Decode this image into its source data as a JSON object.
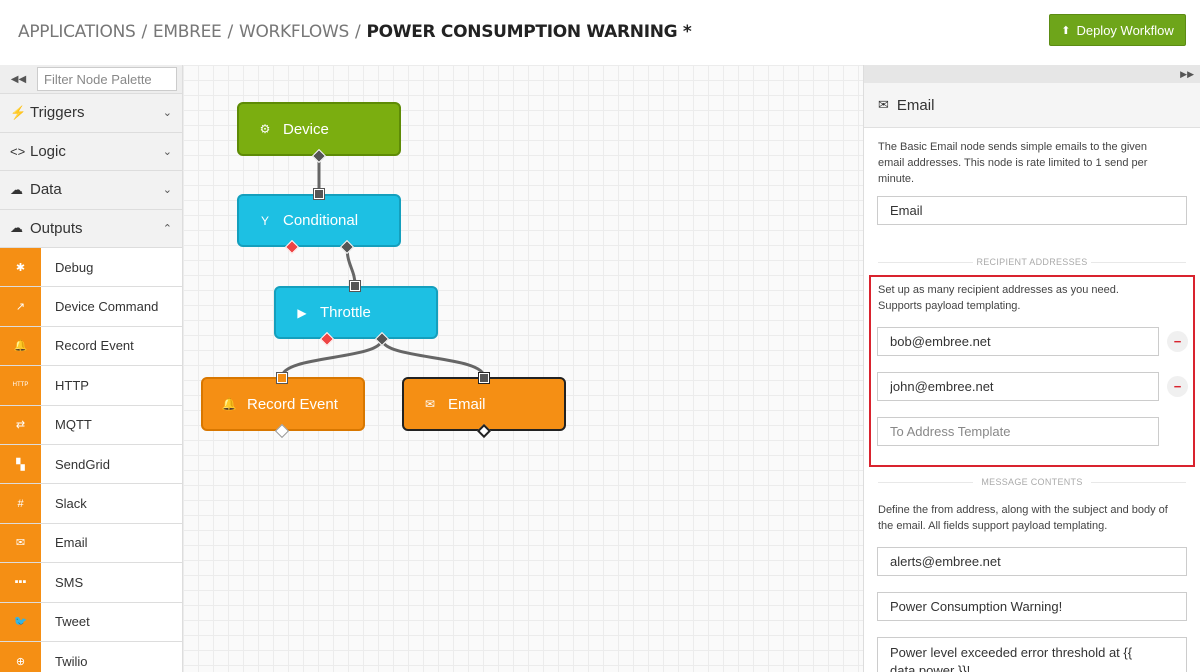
{
  "breadcrumb": {
    "items": [
      "APPLICATIONS",
      "EMBREE",
      "WORKFLOWS"
    ],
    "separator": "/",
    "current": "POWER CONSUMPTION WARNING *"
  },
  "deploy_button": {
    "label": "Deploy Workflow",
    "icon": "upload-icon"
  },
  "sidebar": {
    "filter_placeholder": "Filter Node Palette",
    "categories": [
      {
        "label": "Triggers",
        "icon": "bolt-icon",
        "expanded": false
      },
      {
        "label": "Logic",
        "icon": "code-icon",
        "expanded": false
      },
      {
        "label": "Data",
        "icon": "cloud-download-icon",
        "expanded": false
      },
      {
        "label": "Outputs",
        "icon": "cloud-upload-icon",
        "expanded": true
      }
    ],
    "outputs": [
      {
        "label": "Debug",
        "icon": "bug-icon"
      },
      {
        "label": "Device Command",
        "icon": "arrow-up-right-icon"
      },
      {
        "label": "Record Event",
        "icon": "bell-icon"
      },
      {
        "label": "HTTP",
        "icon": "http-icon"
      },
      {
        "label": "MQTT",
        "icon": "exchange-icon"
      },
      {
        "label": "SendGrid",
        "icon": "sendgrid-icon"
      },
      {
        "label": "Slack",
        "icon": "slack-icon"
      },
      {
        "label": "Email",
        "icon": "envelope-icon"
      },
      {
        "label": "SMS",
        "icon": "chat-icon"
      },
      {
        "label": "Tweet",
        "icon": "twitter-icon"
      },
      {
        "label": "Twilio",
        "icon": "twilio-icon"
      }
    ],
    "accent": "#f58f14"
  },
  "canvas": {
    "nodes": [
      {
        "label": "Device",
        "icon": "chip-icon",
        "color": "#7bae10"
      },
      {
        "label": "Conditional",
        "icon": "fork-icon",
        "color": "#1dc0e3"
      },
      {
        "label": "Throttle",
        "icon": "play-circle-icon",
        "color": "#1dc0e3"
      },
      {
        "label": "Record Event",
        "icon": "bell-icon",
        "color": "#f58f14"
      },
      {
        "label": "Email",
        "icon": "envelope-icon",
        "color": "#f58f14",
        "selected": true
      }
    ]
  },
  "panel": {
    "title": "Email",
    "title_icon": "envelope-icon",
    "description": "The Basic Email node sends simple emails to the given email addresses. This node is rate limited to 1 send per minute.",
    "node_name": "Email",
    "recipient_section_label": "RECIPIENT ADDRESSES",
    "recipient_description": "Set up as many recipient addresses as you need. Supports payload templating.",
    "recipients": [
      "bob@embree.net",
      "john@embree.net"
    ],
    "recipient_placeholder": "To Address Template",
    "message_section_label": "MESSAGE CONTENTS",
    "message_description": "Define the from address, along with the subject and body of the email. All fields support payload templating.",
    "from_address": "alerts@embree.net",
    "subject": "Power Consumption Warning!",
    "body": "Power level exceeded error threshold at {{ data.power }}!",
    "highlight_color": "#d9232e"
  }
}
